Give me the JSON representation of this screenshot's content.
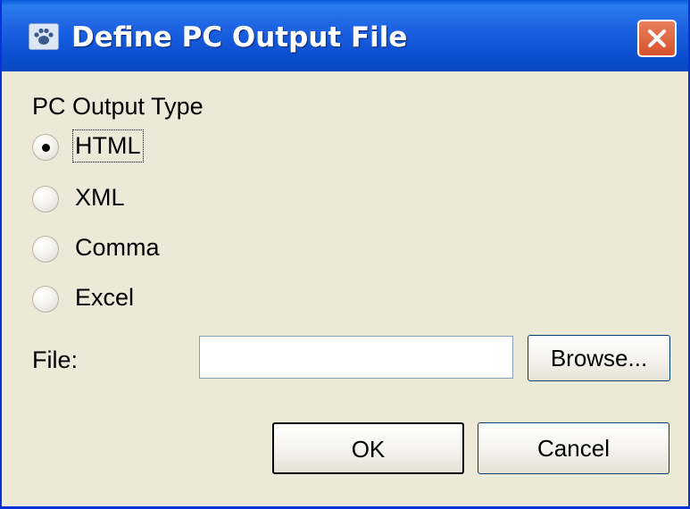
{
  "window": {
    "title": "Define PC Output File",
    "app_icon": "pawprint-icon",
    "close_icon": "close-icon"
  },
  "output_type": {
    "group_label": "PC Output Type",
    "options": [
      {
        "label": "HTML",
        "selected": true
      },
      {
        "label": "XML",
        "selected": false
      },
      {
        "label": "Comma",
        "selected": false
      },
      {
        "label": "Excel",
        "selected": false
      }
    ]
  },
  "file": {
    "label": "File:",
    "value": "",
    "browse_label": "Browse..."
  },
  "buttons": {
    "ok_label": "OK",
    "cancel_label": "Cancel"
  },
  "colors": {
    "titlebar": "#0a4ecf",
    "dialog_background": "#ece9d8",
    "close_button": "#d7522d"
  }
}
